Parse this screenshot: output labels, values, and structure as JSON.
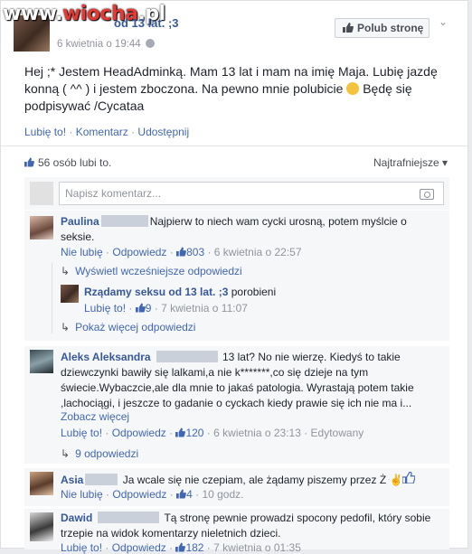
{
  "watermark": {
    "part1": "www.",
    "part2": "wiocha",
    "part3": ".pl"
  },
  "post": {
    "page_name": "od 13 lat. ;3",
    "date": "6 kwietnia o 19:44",
    "like_page_label": "Polub stronę",
    "text": "Hej ;* Jestem HeadAdminką. Mam 13 lat i mam na imię Maja. Lubię jazdę konną ( ^^ ) i jestem zboczona. Na pewno mnie polubicie",
    "text2": "Będę się podpisywać /Cycataa",
    "actions": {
      "like": "Lubię to!",
      "comment": "Komentarz",
      "share": "Udostępnij"
    },
    "likes_count": "56 osób lubi to.",
    "sort_label": "Najtrafniejsze"
  },
  "comment_input": {
    "placeholder": "Napisz komentarz..."
  },
  "comments": [
    {
      "name": "Paulina",
      "text": "Najpierw to niech wam cycki urosną, potem myślcie o seksie.",
      "unlike": "Nie lubię",
      "reply": "Odpowiedz",
      "likes": "803",
      "time": "6 kwietnia o 22:57",
      "show_earlier": "Wyświetl wcześniejsze odpowiedzi",
      "reply_item": {
        "name": "Rządamy seksu od 13 lat. ;3",
        "text": "porobieni",
        "like": "Lubię to!",
        "likes": "9",
        "time": "7 kwietnia o 11:07"
      },
      "show_more": "Pokaż więcej odpowiedzi"
    },
    {
      "name": "Aleks Aleksandra",
      "text": "13 lat? No nie wierzę. Kiedyś to takie dziewczynki bawiły się lalkami,a nie k*******,co się dzieje na tym świecie.Wybaczcie,ale dla mnie to jakaś patologia. Wyrastają potem takie ,lachociągi, i jeszcze to gadanie o cyckach kiedy prawie się ich nie ma i...",
      "see_more": "Zobacz więcej",
      "like": "Lubię to!",
      "reply": "Odpowiedz",
      "likes": "120",
      "time": "6 kwietnia o 23:13",
      "edited": "Edytowany",
      "replies": "9 odpowiedzi"
    },
    {
      "name": "Asia",
      "text": "Ja wcale się nie czepiam, ale żądamy piszemy przez Ż",
      "unlike": "Nie lubię",
      "reply": "Odpowiedz",
      "likes": "4",
      "time": "10 godz."
    },
    {
      "name": "Dawid",
      "text": "Tą stronę pewnie prowadzi spocony pedofil, który sobie trzepie na widok komentarzy nieletnich dzieci.",
      "like": "Lubię to!",
      "reply": "Odpowiedz",
      "likes": "182",
      "time": "7 kwietnia o 01:35"
    }
  ],
  "colors": {
    "link": "#4267b2",
    "name": "#365899",
    "meta": "#90949c",
    "bg": "#f6f7f9"
  }
}
